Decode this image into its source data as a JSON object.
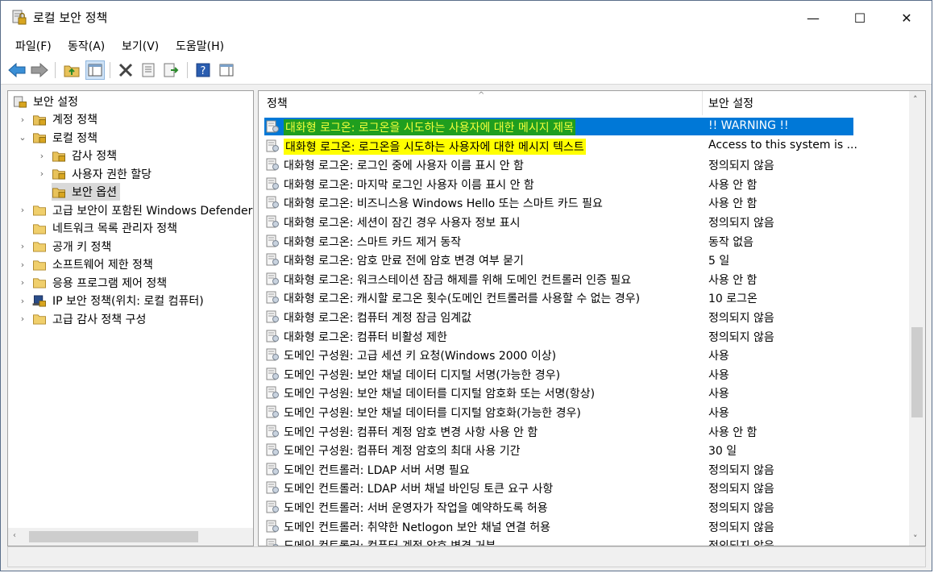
{
  "window": {
    "title": "로컬 보안 정책",
    "minimize": "—",
    "maximize": "☐",
    "close": "✕"
  },
  "menu": [
    "파일(F)",
    "동작(A)",
    "보기(V)",
    "도움말(H)"
  ],
  "toolbar": {
    "icons": [
      "back-icon",
      "forward-icon",
      "up-folder-icon",
      "show-tree-icon",
      "delete-icon",
      "properties-icon",
      "export-icon",
      "help-icon",
      "view-icon"
    ]
  },
  "tree": {
    "root": "보안 설정",
    "items": [
      {
        "label": "계정 정책",
        "level": 1,
        "expander": "›"
      },
      {
        "label": "로컬 정책",
        "level": 1,
        "expander": "⌄"
      },
      {
        "label": "감사 정책",
        "level": 2,
        "expander": "›"
      },
      {
        "label": "사용자 권한 할당",
        "level": 2,
        "expander": "›"
      },
      {
        "label": "보안 옵션",
        "level": 2,
        "expander": "",
        "selected": true
      },
      {
        "label": "고급 보안이 포함된 Windows Defender",
        "level": 1,
        "expander": "›"
      },
      {
        "label": "네트워크 목록 관리자 정책",
        "level": 1,
        "expander": ""
      },
      {
        "label": "공개 키 정책",
        "level": 1,
        "expander": "›"
      },
      {
        "label": "소프트웨어 제한 정책",
        "level": 1,
        "expander": "›"
      },
      {
        "label": "응용 프로그램 제어 정책",
        "level": 1,
        "expander": "›"
      },
      {
        "label": "IP 보안 정책(위치: 로컬 컴퓨터)",
        "level": 1,
        "expander": "›",
        "icon": "ip-security-icon"
      },
      {
        "label": "고급 감사 정책 구성",
        "level": 1,
        "expander": "›"
      }
    ]
  },
  "list": {
    "columns": {
      "policy": "정책",
      "setting": "보안 설정"
    },
    "rows": [
      {
        "name": "대화형 로그온: 로그온을 시도하는 사용자에 대한 메시지 제목",
        "value": "!! WARNING !!",
        "selected": true,
        "highlight": "green"
      },
      {
        "name": "대화형 로그온: 로그온을 시도하는 사용자에 대한 메시지 텍스트",
        "value": "Access to this system is ...",
        "highlight": "yellow"
      },
      {
        "name": "대화형 로그온: 로그인 중에 사용자 이름 표시 안 함",
        "value": "정의되지 않음"
      },
      {
        "name": "대화형 로그온: 마지막 로그인 사용자 이름 표시 안 함",
        "value": "사용 안 함"
      },
      {
        "name": "대화형 로그온: 비즈니스용 Windows Hello 또는 스마트 카드 필요",
        "value": "사용 안 함"
      },
      {
        "name": "대화형 로그온: 세션이 잠긴 경우 사용자 정보 표시",
        "value": "정의되지 않음"
      },
      {
        "name": "대화형 로그온: 스마트 카드 제거 동작",
        "value": "동작 없음"
      },
      {
        "name": "대화형 로그온: 암호 만료 전에 암호 변경 여부 묻기",
        "value": "5 일"
      },
      {
        "name": "대화형 로그온: 워크스테이션 잠금 해제를 위해 도메인 컨트롤러 인증 필요",
        "value": "사용 안 함"
      },
      {
        "name": "대화형 로그온: 캐시할 로그온 횟수(도메인 컨트롤러를 사용할 수 없는 경우)",
        "value": "10 로그온"
      },
      {
        "name": "대화형 로그온: 컴퓨터 계정 잠금 임계값",
        "value": "정의되지 않음"
      },
      {
        "name": "대화형 로그온: 컴퓨터 비활성 제한",
        "value": "정의되지 않음"
      },
      {
        "name": "도메인 구성원: 고급 세션 키 요청(Windows 2000 이상)",
        "value": "사용"
      },
      {
        "name": "도메인 구성원: 보안 채널 데이터 디지털 서명(가능한 경우)",
        "value": "사용"
      },
      {
        "name": "도메인 구성원: 보안 채널 데이터를 디지털 암호화 또는 서명(항상)",
        "value": "사용"
      },
      {
        "name": "도메인 구성원: 보안 채널 데이터를 디지털 암호화(가능한 경우)",
        "value": "사용"
      },
      {
        "name": "도메인 구성원: 컴퓨터 계정 암호 변경 사항 사용 안 함",
        "value": "사용 안 함"
      },
      {
        "name": "도메인 구성원: 컴퓨터 계정 암호의 최대 사용 기간",
        "value": "30 일"
      },
      {
        "name": "도메인 컨트롤러: LDAP 서버 서명 필요",
        "value": "정의되지 않음"
      },
      {
        "name": "도메인 컨트롤러: LDAP 서버 채널 바인딩 토큰 요구 사항",
        "value": "정의되지 않음"
      },
      {
        "name": "도메인 컨트롤러: 서버 운영자가 작업을 예약하도록 허용",
        "value": "정의되지 않음"
      },
      {
        "name": "도메인 컨트롤러: 취약한 Netlogon 보안 채널 연결 허용",
        "value": "정의되지 않음"
      },
      {
        "name": "도메인 컨트롤러: 컴퓨터 계정 암호 변경 거부",
        "value": "정의되지 않음"
      }
    ]
  },
  "colors": {
    "selection": "#0078d7",
    "highlight_green": "#1f9e1f",
    "highlight_yellow": "#ffff00"
  }
}
